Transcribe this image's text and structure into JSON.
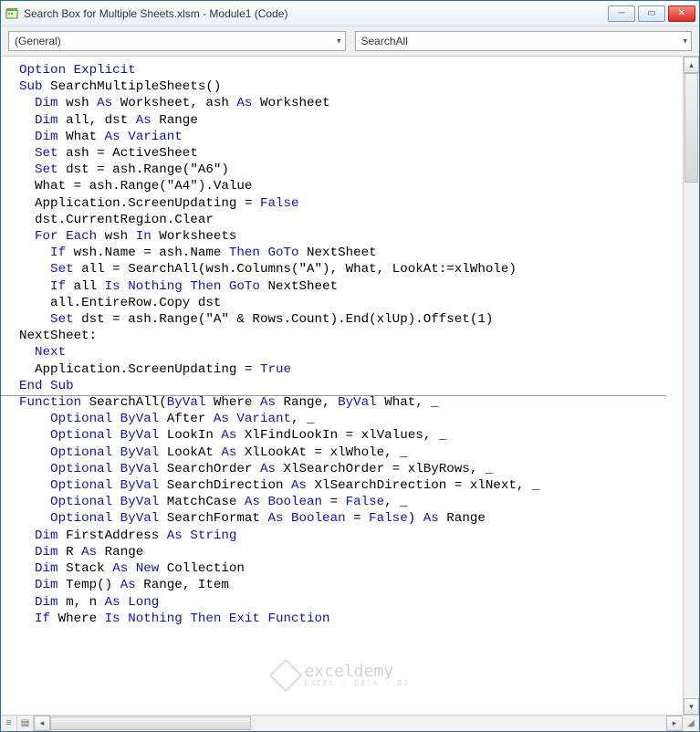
{
  "window": {
    "title": "Search Box for Multiple Sheets.xlsm - Module1 (Code)"
  },
  "dropdowns": {
    "left": "(General)",
    "right": "SearchAll"
  },
  "code": {
    "line01a": "Option Explicit",
    "line02a": "Sub",
    "line02b": " SearchMultipleSheets()",
    "line03a": "  Dim",
    "line03b": " wsh ",
    "line03c": "As",
    "line03d": " Worksheet, ash ",
    "line03e": "As",
    "line03f": " Worksheet",
    "line04a": "  Dim",
    "line04b": " all, dst ",
    "line04c": "As",
    "line04d": " Range",
    "line05a": "  Dim",
    "line05b": " What ",
    "line05c": "As Variant",
    "line06a": "  Set",
    "line06b": " ash = ActiveSheet",
    "line07a": "  Set",
    "line07b": " dst = ash.Range(\"A6\")",
    "line08": "  What = ash.Range(\"A4\").Value",
    "line09a": "  Application.ScreenUpdating = ",
    "line09b": "False",
    "line10": "  dst.CurrentRegion.Clear",
    "line11a": "  For Each",
    "line11b": " wsh ",
    "line11c": "In",
    "line11d": " Worksheets",
    "line12a": "    If",
    "line12b": " wsh.Name = ash.Name ",
    "line12c": "Then GoTo",
    "line12d": " NextSheet",
    "line13a": "    Set",
    "line13b": " all = SearchAll(wsh.Columns(\"A\"), What, LookAt:=xlWhole)",
    "line14a": "    If",
    "line14b": " all ",
    "line14c": "Is Nothing Then GoTo",
    "line14d": " NextSheet",
    "line15": "    all.EntireRow.Copy dst",
    "line16a": "    Set",
    "line16b": " dst = ash.Range(\"A\" & Rows.Count).End(xlUp).Offset(1)",
    "line17": "NextSheet:",
    "line18a": "  Next",
    "line19a": "  Application.ScreenUpdating = ",
    "line19b": "True",
    "line20a": "End Sub",
    "line21a": "Function",
    "line21b": " SearchAll(",
    "line21c": "ByVal",
    "line21d": " Where ",
    "line21e": "As",
    "line21f": " Range, ",
    "line21g": "ByVal",
    "line21h": " What, _",
    "line22a": "    Optional ByVal",
    "line22b": " After ",
    "line22c": "As Variant",
    "line22d": ", _",
    "line23a": "    Optional ByVal",
    "line23b": " LookIn ",
    "line23c": "As",
    "line23d": " XlFindLookIn = xlValues, _",
    "line24a": "    Optional ByVal",
    "line24b": " LookAt ",
    "line24c": "As",
    "line24d": " XlLookAt = xlWhole, _",
    "line25a": "    Optional ByVal",
    "line25b": " SearchOrder ",
    "line25c": "As",
    "line25d": " XlSearchOrder = xlByRows, _",
    "line26a": "    Optional ByVal",
    "line26b": " SearchDirection ",
    "line26c": "As",
    "line26d": " XlSearchDirection = xlNext, _",
    "line27a": "    Optional ByVal",
    "line27b": " MatchCase ",
    "line27c": "As Boolean",
    "line27d": " = ",
    "line27e": "False",
    "line27f": ", _",
    "line28a": "    Optional ByVal",
    "line28b": " SearchFormat ",
    "line28c": "As Boolean",
    "line28d": " = ",
    "line28e": "False",
    "line28f": ") ",
    "line28g": "As",
    "line28h": " Range",
    "line29a": "  Dim",
    "line29b": " FirstAddress ",
    "line29c": "As String",
    "line30a": "  Dim",
    "line30b": " R ",
    "line30c": "As",
    "line30d": " Range",
    "line31a": "  Dim",
    "line31b": " Stack ",
    "line31c": "As New",
    "line31d": " Collection",
    "line32a": "  Dim",
    "line32b": " Temp() ",
    "line32c": "As",
    "line32d": " Range, Item",
    "line33a": "  Dim",
    "line33b": " m, n ",
    "line33c": "As Long",
    "line34a": "  If",
    "line34b": " Where ",
    "line34c": "Is Nothing Then Exit Function"
  },
  "watermark": {
    "text": "exceldemy",
    "sub": "EXCEL · DATA · BI"
  }
}
